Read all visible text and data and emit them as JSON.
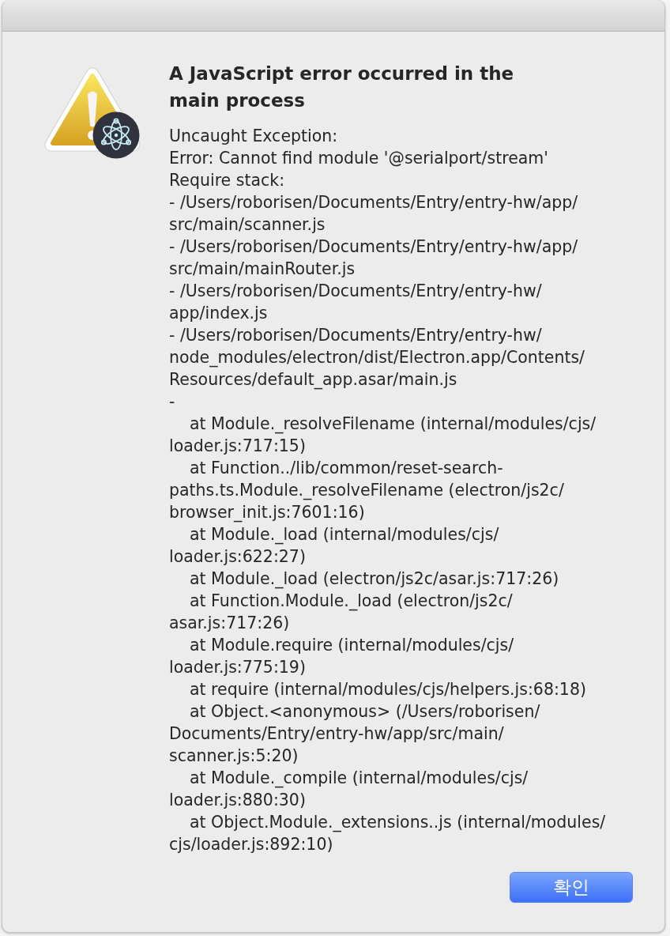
{
  "dialog": {
    "title": "A JavaScript error occurred in the main process",
    "message_lines": [
      {
        "text": "Uncaught Exception:",
        "indented": false
      },
      {
        "text": "Error: Cannot find module '@serialport/stream'",
        "indented": false
      },
      {
        "text": "Require stack:",
        "indented": false
      },
      {
        "text": "- /Users/roborisen/Documents/Entry/entry-hw/app/",
        "indented": false
      },
      {
        "text": "src/main/scanner.js",
        "indented": false
      },
      {
        "text": "- /Users/roborisen/Documents/Entry/entry-hw/app/",
        "indented": false
      },
      {
        "text": "src/main/mainRouter.js",
        "indented": false
      },
      {
        "text": "- /Users/roborisen/Documents/Entry/entry-hw/",
        "indented": false
      },
      {
        "text": "app/index.js",
        "indented": false
      },
      {
        "text": "- /Users/roborisen/Documents/Entry/entry-hw/",
        "indented": false
      },
      {
        "text": "node_modules/electron/dist/Electron.app/Contents/",
        "indented": false
      },
      {
        "text": "Resources/default_app.asar/main.js",
        "indented": false
      },
      {
        "text": "-",
        "indented": false
      },
      {
        "text": "at Module._resolveFilename (internal/modules/cjs/",
        "indented": true
      },
      {
        "text": "loader.js:717:15)",
        "indented": false
      },
      {
        "text": "at Function../lib/common/reset-search-",
        "indented": true
      },
      {
        "text": "paths.ts.Module._resolveFilename (electron/js2c/",
        "indented": false
      },
      {
        "text": "browser_init.js:7601:16)",
        "indented": false
      },
      {
        "text": "at Module._load (internal/modules/cjs/",
        "indented": true
      },
      {
        "text": "loader.js:622:27)",
        "indented": false
      },
      {
        "text": "at Module._load (electron/js2c/asar.js:717:26)",
        "indented": true
      },
      {
        "text": "at Function.Module._load (electron/js2c/",
        "indented": true
      },
      {
        "text": "asar.js:717:26)",
        "indented": false
      },
      {
        "text": "at Module.require (internal/modules/cjs/",
        "indented": true
      },
      {
        "text": "loader.js:775:19)",
        "indented": false
      },
      {
        "text": "at require (internal/modules/cjs/helpers.js:68:18)",
        "indented": true
      },
      {
        "text": "at Object.<anonymous> (/Users/roborisen/",
        "indented": true
      },
      {
        "text": "Documents/Entry/entry-hw/app/src/main/",
        "indented": false
      },
      {
        "text": "scanner.js:5:20)",
        "indented": false
      },
      {
        "text": "at Module._compile (internal/modules/cjs/",
        "indented": true
      },
      {
        "text": "loader.js:880:30)",
        "indented": false
      },
      {
        "text": "at Object.Module._extensions..js (internal/modules/",
        "indented": true
      },
      {
        "text": "cjs/loader.js:892:10)",
        "indented": false
      }
    ],
    "buttons": [
      {
        "label": "확인",
        "kind": "default"
      }
    ]
  }
}
